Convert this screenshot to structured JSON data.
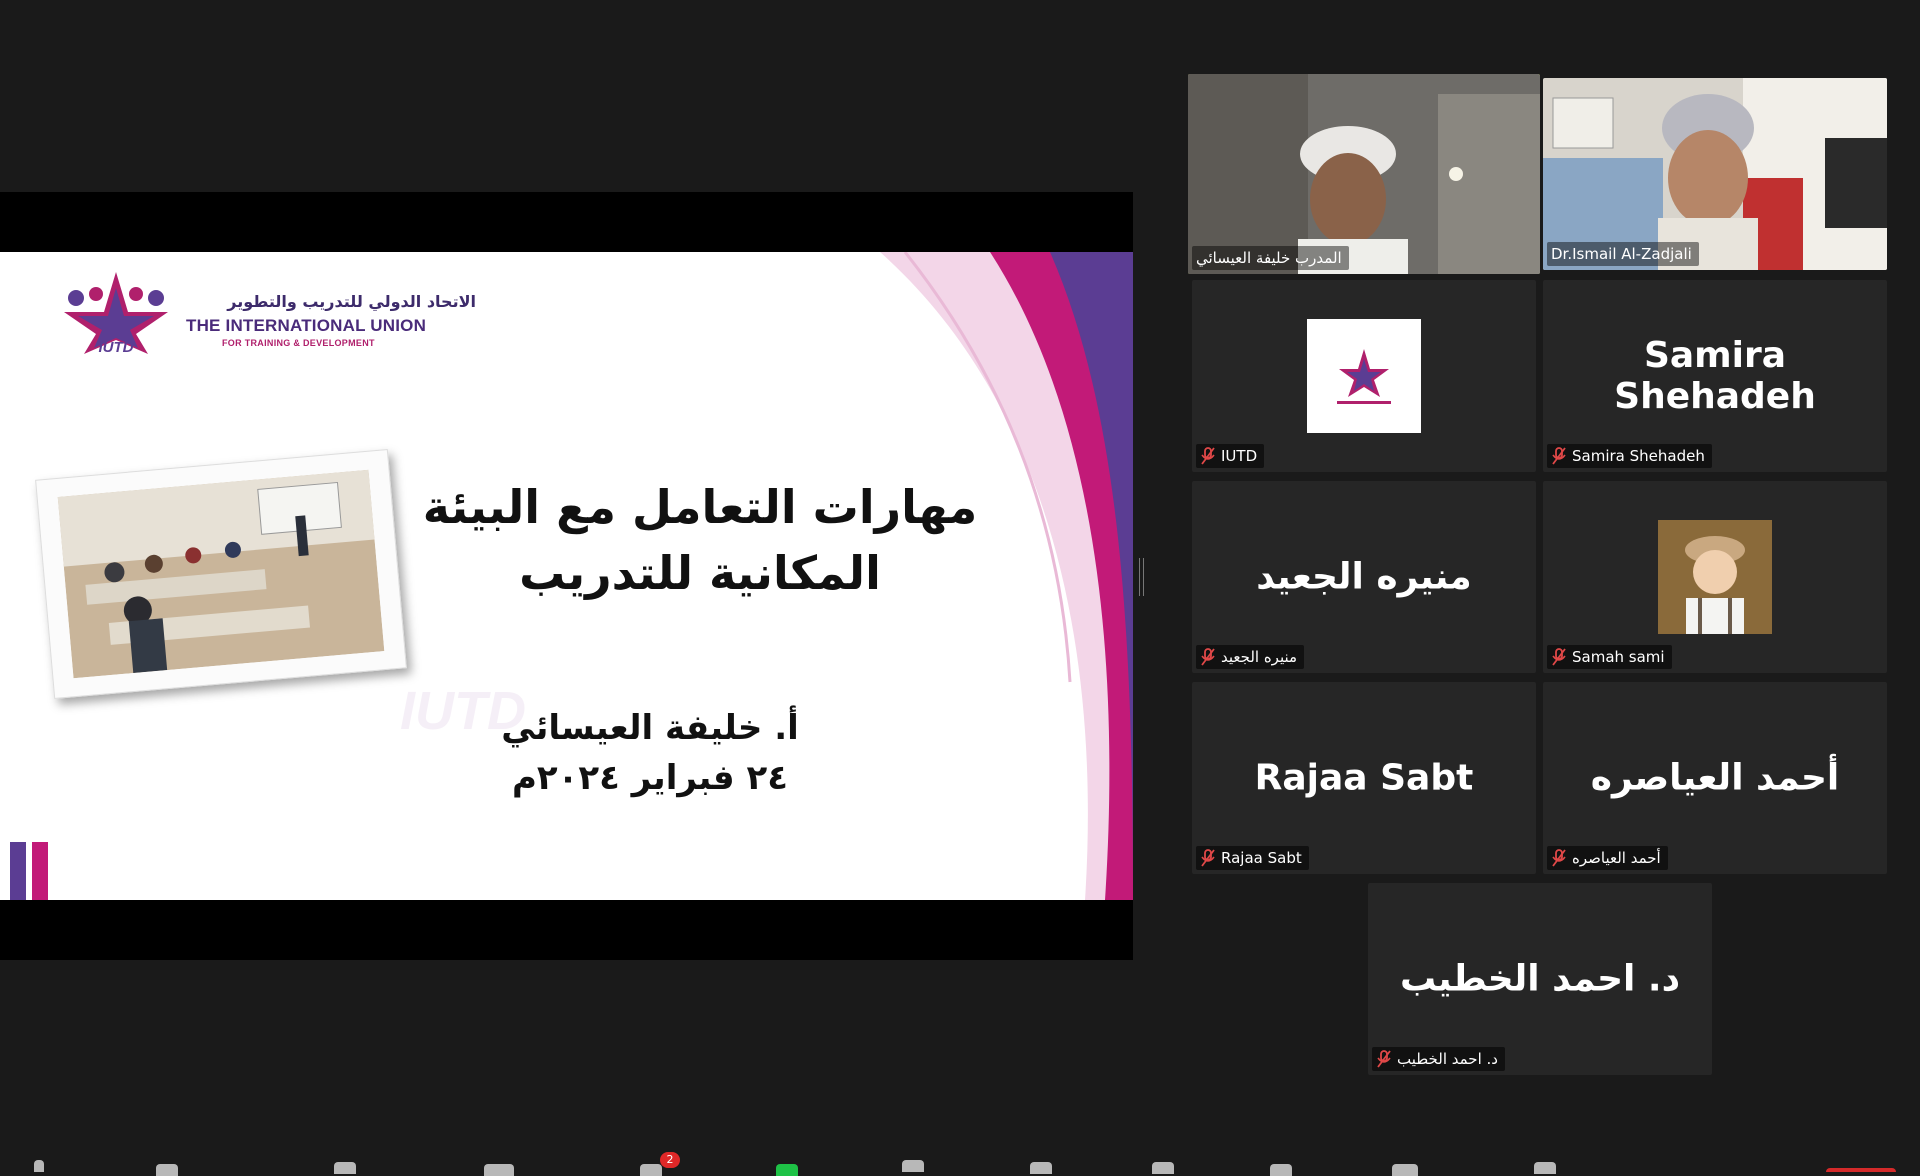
{
  "presentation": {
    "logo_arabic": "الاتحاد الدولي للتدريب والتطوير",
    "logo_english": "THE INTERNATIONAL UNION",
    "logo_subtitle": "FOR TRAINING & DEVELOPMENT",
    "logo_acronym": "IUTD",
    "title_line1": "مهارات التعامل مع البيئة",
    "title_line2": "المكانية للتدريب",
    "presenter": "أ. خليفة العيسائي",
    "date": "٢٤ فبراير ٢٠٢٤م"
  },
  "gallery": {
    "tiles": [
      {
        "id": "t1",
        "type": "video",
        "label": "المدرب خليفة العيسائي",
        "speaking": true,
        "muted": false
      },
      {
        "id": "t2",
        "type": "video",
        "label": "Dr.Ismail Al-Zadjali",
        "speaking": false,
        "muted": false
      },
      {
        "id": "t3",
        "type": "avatar-logo",
        "label": "IUTD",
        "muted": true
      },
      {
        "id": "t4",
        "type": "name",
        "display": "Samira Shehadeh",
        "label": "Samira Shehadeh",
        "muted": true
      },
      {
        "id": "t5",
        "type": "name",
        "display": "منيره الجعيد",
        "label": "منيره الجعيد",
        "muted": true
      },
      {
        "id": "t6",
        "type": "avatar-photo",
        "label": "Samah sami",
        "muted": true
      },
      {
        "id": "t7",
        "type": "name",
        "display": "Rajaa Sabt",
        "label": "Rajaa Sabt",
        "muted": true
      },
      {
        "id": "t8",
        "type": "name",
        "display": "أحمد العياصره",
        "label": "أحمد العياصره",
        "muted": true
      },
      {
        "id": "t9",
        "type": "name",
        "display": "د. احمد الخطيب",
        "label": "د. احمد الخطيب",
        "muted": true
      }
    ]
  },
  "toolbar": {
    "chat_badge": "2",
    "icons": [
      "mic-icon",
      "video-icon",
      "security-icon",
      "participants-icon",
      "chat-icon",
      "share-screen-icon",
      "summary-icon",
      "ai-companion-icon",
      "reactions-icon",
      "apps-icon",
      "whiteboard-icon",
      "notes-icon",
      "end-button"
    ]
  },
  "colors": {
    "background": "#1a1a1a",
    "tile": "#262626",
    "speaking_border": "#cde03c",
    "muted_red": "#e04848",
    "brand_purple": "#4a2b7a",
    "brand_magenta": "#b0206c"
  }
}
